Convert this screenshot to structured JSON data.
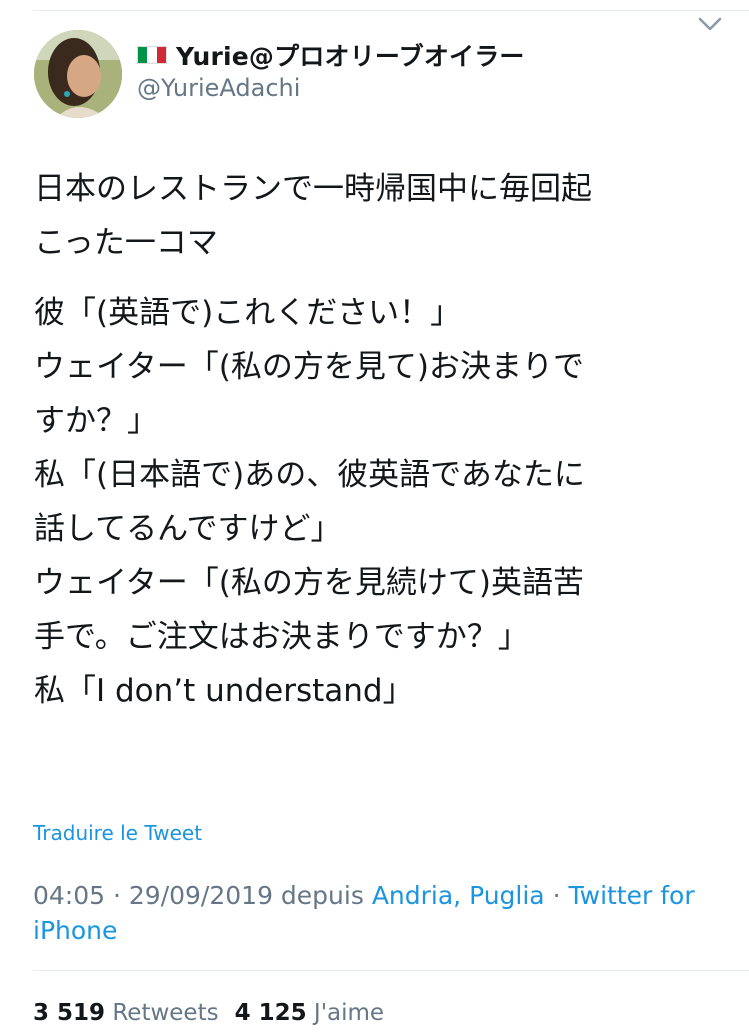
{
  "header": {
    "display_name": "Yurie@プロオリーブオイラー",
    "handle": "@YurieAdachi",
    "flag_colors": [
      "#009246",
      "#ffffff",
      "#ce2b37"
    ]
  },
  "tweet": {
    "lines": [
      "日本のレストランで一時帰国中に毎回起",
      "こった一コマ",
      "彼「(英語で)これください！」",
      "ウェイター「(私の方を見て)お決まりで",
      "すか？」",
      "私「(日本語で)あの、彼英語であなたに",
      "話してるんですけど」",
      "ウェイター「(私の方を見続けて)英語苦",
      "手で。ご注文はお決まりですか？」",
      "私「I don’t understand」"
    ]
  },
  "translate_label": "Traduire le Tweet",
  "meta": {
    "time": "04:05",
    "sep1": " · ",
    "date": "29/09/2019",
    "depuis": " depuis ",
    "location": "Andria, Puglia",
    "sep2": " · ",
    "client": "Twitter for iPhone"
  },
  "stats": {
    "retweets_count": "3 519",
    "retweets_label": "Retweets",
    "likes_count": "4 125",
    "likes_label": "J'aime"
  },
  "icons": {
    "menu": "chevron-down-icon",
    "avatar": "profile-photo"
  },
  "colors": {
    "link": "#1b95e0",
    "secondary_text": "#657786",
    "text": "#14171a"
  }
}
